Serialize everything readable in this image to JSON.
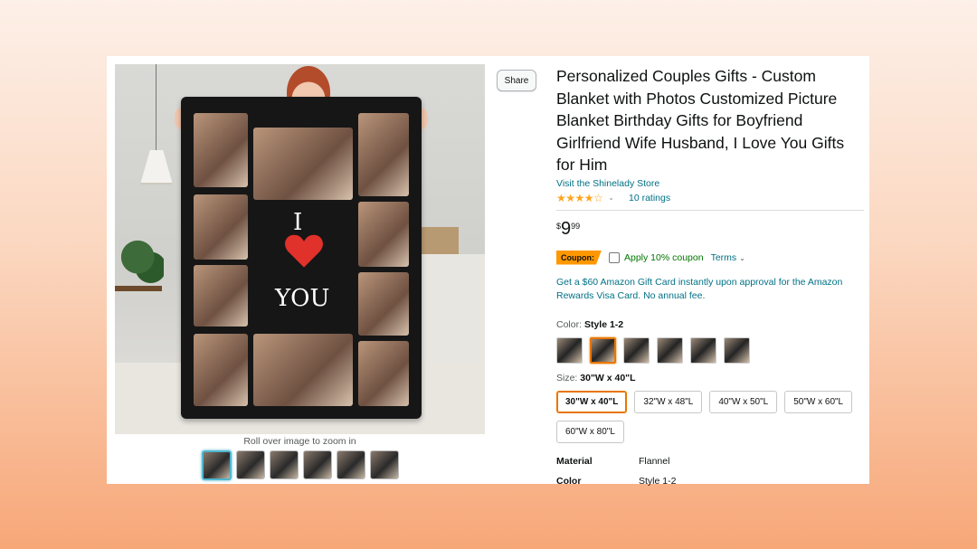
{
  "product": {
    "title": "Personalized Couples Gifts - Custom Blanket with Photos Customized Picture Blanket Birthday Gifts for Boyfriend Girlfriend Wife Husband, I Love You Gifts for Him",
    "store_link": "Visit the Shinelady Store",
    "rating": {
      "stars": "★★★★☆",
      "value": 4.2,
      "count_text": "10 ratings"
    },
    "price": {
      "symbol": "$",
      "whole": "9",
      "fraction": "99"
    },
    "coupon": {
      "badge": "Coupon:",
      "text": "Apply 10% coupon",
      "terms": "Terms"
    },
    "giftcard_text": "Get a $60 Amazon Gift Card instantly upon approval for the Amazon Rewards Visa Card. No annual fee.",
    "color": {
      "label": "Color:",
      "selected": "Style 1-2",
      "swatch_count": 6,
      "selected_index": 1
    },
    "size": {
      "label": "Size:",
      "selected": "30\"W x 40\"L",
      "options": [
        "30\"W x 40\"L",
        "32\"W x 48\"L",
        "40\"W x 50\"L",
        "50\"W x 60\"L",
        "60\"W x 80\"L"
      ]
    },
    "specs": [
      {
        "key": "Material",
        "value": "Flannel"
      },
      {
        "key": "Color",
        "value": "Style 1-2"
      }
    ]
  },
  "gallery": {
    "share_label": "Share",
    "zoom_note": "Roll over image to zoom in",
    "blanket_text": {
      "line1": "I",
      "line2": "YOU"
    },
    "thumb_count": 6
  },
  "colors": {
    "link": "#007185",
    "coupon_badge": "#ff9800",
    "selected_border": "#e77600",
    "stars": "#ffa41c",
    "heart": "#e0312b"
  }
}
